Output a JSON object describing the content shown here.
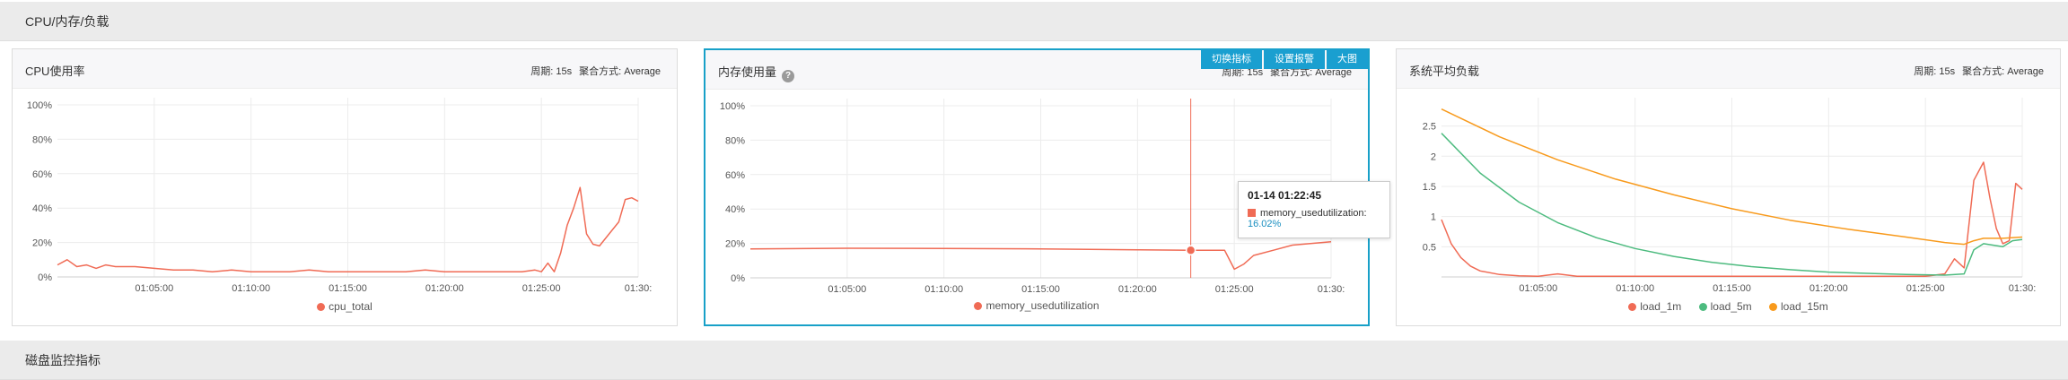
{
  "sections": {
    "top": "CPU/内存/负载",
    "bottom": "磁盘监控指标"
  },
  "panels": [
    {
      "title": "CPU使用率",
      "period_label": "周期: 15s",
      "agg_label": "聚合方式: Average",
      "legend": [
        "cpu_total"
      ]
    },
    {
      "title": "内存使用量",
      "period_label": "周期: 15s",
      "agg_label": "聚合方式: Average",
      "legend": [
        "memory_usedutilization"
      ],
      "actions": [
        "切换指标",
        "设置报警",
        "大图"
      ],
      "tooltip": {
        "time": "01-14 01:22:45",
        "series": "memory_usedutilization:",
        "value": "16.02%"
      }
    },
    {
      "title": "系统平均负载",
      "period_label": "周期: 15s",
      "agg_label": "聚合方式: Average",
      "legend": [
        "load_1m",
        "load_5m",
        "load_15m"
      ]
    }
  ],
  "colors": {
    "red": "#f06b55",
    "green": "#4dbb7f",
    "orange": "#f89a1c",
    "accent": "#1a9fd0"
  },
  "chart_data": [
    {
      "type": "line",
      "title": "CPU使用率",
      "x_ticks": [
        "01:05:00",
        "01:10:00",
        "01:15:00",
        "01:20:00",
        "01:25:00",
        "01:30:"
      ],
      "y_ticks": [
        "0%",
        "20%",
        "40%",
        "60%",
        "80%",
        "100%"
      ],
      "ylim": [
        0,
        100
      ],
      "x_range": [
        "01:00:00",
        "01:30:00"
      ],
      "grid": true,
      "series": [
        {
          "name": "cpu_total",
          "color": "#f06b55",
          "x": [
            "01:00:00",
            "01:00:30",
            "01:01:00",
            "01:01:30",
            "01:02:00",
            "01:02:30",
            "01:03:00",
            "01:04:00",
            "01:05:00",
            "01:06:00",
            "01:07:00",
            "01:08:00",
            "01:09:00",
            "01:10:00",
            "01:11:00",
            "01:12:00",
            "01:13:00",
            "01:14:00",
            "01:15:00",
            "01:16:00",
            "01:17:00",
            "01:18:00",
            "01:19:00",
            "01:20:00",
            "01:21:00",
            "01:22:00",
            "01:23:00",
            "01:24:00",
            "01:24:40",
            "01:25:00",
            "01:25:20",
            "01:25:40",
            "01:26:00",
            "01:26:20",
            "01:26:40",
            "01:27:00",
            "01:27:20",
            "01:27:40",
            "01:28:00",
            "01:28:30",
            "01:29:00",
            "01:29:20",
            "01:29:40",
            "01:30:00"
          ],
          "y": [
            7,
            10,
            6,
            7,
            5,
            7,
            6,
            6,
            5,
            4,
            4,
            3,
            4,
            3,
            3,
            3,
            4,
            3,
            3,
            3,
            3,
            3,
            4,
            3,
            3,
            3,
            3,
            3,
            4,
            3,
            8,
            3,
            14,
            30,
            40,
            52,
            25,
            19,
            18,
            25,
            32,
            45,
            46,
            44
          ]
        }
      ]
    },
    {
      "type": "line",
      "title": "内存使用量",
      "x_ticks": [
        "01:05:00",
        "01:10:00",
        "01:15:00",
        "01:20:00",
        "01:25:00",
        "01:30:"
      ],
      "y_ticks": [
        "0%",
        "20%",
        "40%",
        "60%",
        "80%",
        "100%"
      ],
      "ylim": [
        0,
        100
      ],
      "x_range": [
        "01:00:00",
        "01:30:00"
      ],
      "grid": true,
      "series": [
        {
          "name": "memory_usedutilization",
          "color": "#f06b55",
          "x": [
            "01:00:00",
            "01:05:00",
            "01:10:00",
            "01:15:00",
            "01:20:00",
            "01:22:45",
            "01:23:30",
            "01:24:30",
            "01:25:00",
            "01:25:30",
            "01:26:00",
            "01:27:00",
            "01:28:00",
            "01:29:00",
            "01:30:00"
          ],
          "y": [
            16.8,
            17.2,
            17.1,
            16.8,
            16.3,
            16.02,
            16,
            16,
            5,
            8,
            13,
            16,
            19,
            20,
            21
          ]
        }
      ],
      "crosshair_x": "01:22:45"
    },
    {
      "type": "line",
      "title": "系统平均负载",
      "x_ticks": [
        "01:05:00",
        "01:10:00",
        "01:15:00",
        "01:20:00",
        "01:25:00",
        "01:30:"
      ],
      "y_ticks": [
        "0.5",
        "1",
        "1.5",
        "2",
        "2.5"
      ],
      "ylim": [
        0,
        2.85
      ],
      "x_range": [
        "01:00:00",
        "01:30:00"
      ],
      "grid": true,
      "series": [
        {
          "name": "load_1m",
          "color": "#f06b55",
          "x": [
            "01:00:00",
            "01:00:30",
            "01:01:00",
            "01:01:30",
            "01:02:00",
            "01:03:00",
            "01:04:00",
            "01:05:00",
            "01:06:00",
            "01:07:00",
            "01:08:00",
            "01:10:00",
            "01:15:00",
            "01:20:00",
            "01:25:00",
            "01:26:00",
            "01:26:30",
            "01:27:00",
            "01:27:30",
            "01:28:00",
            "01:28:20",
            "01:28:40",
            "01:29:00",
            "01:29:20",
            "01:29:40",
            "01:30:00"
          ],
          "y": [
            0.95,
            0.55,
            0.32,
            0.18,
            0.1,
            0.04,
            0.02,
            0.01,
            0.05,
            0.01,
            0.01,
            0.01,
            0.01,
            0.01,
            0.01,
            0.05,
            0.3,
            0.15,
            1.6,
            1.9,
            1.3,
            0.8,
            0.55,
            0.6,
            1.55,
            1.45
          ]
        },
        {
          "name": "load_5m",
          "color": "#4dbb7f",
          "x": [
            "01:00:00",
            "01:02:00",
            "01:04:00",
            "01:06:00",
            "01:08:00",
            "01:10:00",
            "01:12:00",
            "01:14:00",
            "01:16:00",
            "01:18:00",
            "01:20:00",
            "01:22:00",
            "01:24:00",
            "01:26:00",
            "01:27:00",
            "01:27:30",
            "01:28:00",
            "01:29:00",
            "01:29:30",
            "01:30:00"
          ],
          "y": [
            2.38,
            1.72,
            1.24,
            0.9,
            0.65,
            0.47,
            0.34,
            0.24,
            0.17,
            0.12,
            0.08,
            0.06,
            0.04,
            0.03,
            0.05,
            0.45,
            0.55,
            0.5,
            0.6,
            0.62
          ]
        },
        {
          "name": "load_15m",
          "color": "#f89a1c",
          "x": [
            "01:00:00",
            "01:03:00",
            "01:06:00",
            "01:09:00",
            "01:12:00",
            "01:15:00",
            "01:18:00",
            "01:21:00",
            "01:24:00",
            "01:26:00",
            "01:27:00",
            "01:27:30",
            "01:28:00",
            "01:29:00",
            "01:30:00"
          ],
          "y": [
            2.78,
            2.32,
            1.94,
            1.62,
            1.36,
            1.13,
            0.94,
            0.79,
            0.66,
            0.57,
            0.54,
            0.6,
            0.64,
            0.64,
            0.66
          ]
        }
      ]
    }
  ]
}
